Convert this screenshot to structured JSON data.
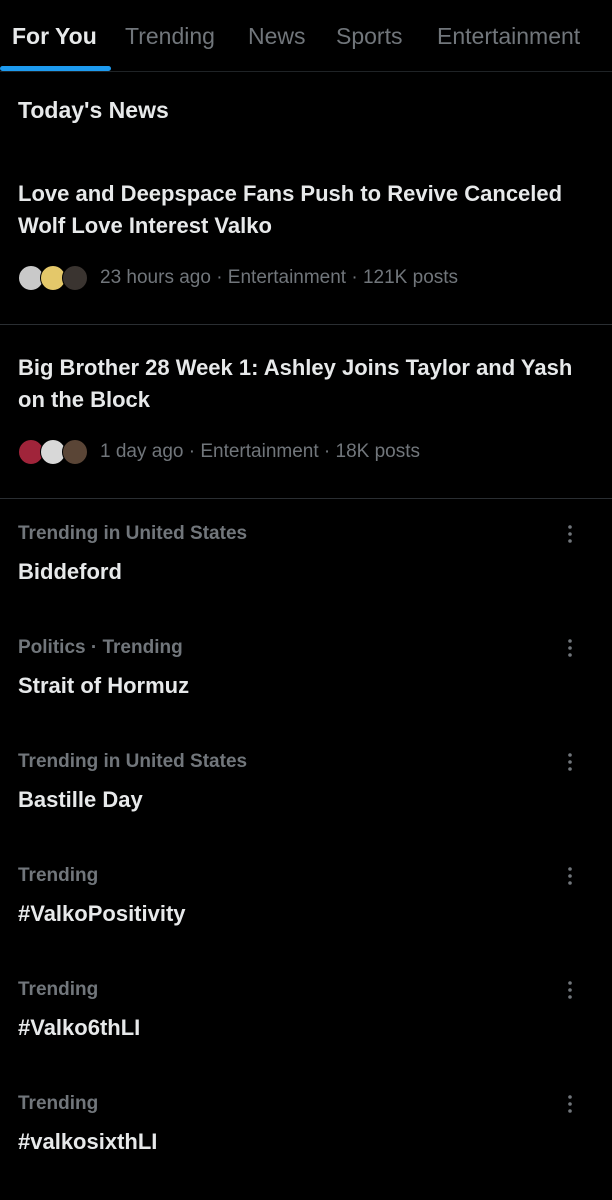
{
  "tabs": [
    {
      "label": "For You",
      "active": true
    },
    {
      "label": "Trending",
      "active": false
    },
    {
      "label": "News",
      "active": false
    },
    {
      "label": "Sports",
      "active": false
    },
    {
      "label": "Entertainment",
      "active": false
    }
  ],
  "section_title": "Today's News",
  "news": [
    {
      "headline": "Love and Deepspace Fans Push to Revive Canceled Wolf Love Interest Valko",
      "meta": "23 hours ago · Entertainment · 121K posts",
      "avatar_colors": [
        "#c9c9c9",
        "#e4c86a",
        "#3a3430"
      ]
    },
    {
      "headline": "Big Brother 28 Week 1: Ashley Joins Taylor and Yash on the Block",
      "meta": "1 day ago · Entertainment · 18K posts",
      "avatar_colors": [
        "#a0243a",
        "#d8d8d8",
        "#5a4536"
      ]
    }
  ],
  "trends": [
    {
      "context": "Trending in United States",
      "name": "Biddeford"
    },
    {
      "context": "Politics · Trending",
      "name": "Strait of Hormuz"
    },
    {
      "context": "Trending in United States",
      "name": "Bastille Day"
    },
    {
      "context": "Trending",
      "name": "#ValkoPositivity"
    },
    {
      "context": "Trending",
      "name": "#Valko6thLI"
    },
    {
      "context": "Trending",
      "name": "#valkosixthLI"
    }
  ],
  "colors": {
    "background": "#000000",
    "text_primary": "#e7e9ea",
    "text_secondary": "#71767b",
    "accent": "#1d9bf0",
    "divider": "#2a2e32"
  },
  "icons": {
    "more": "more-vertical-icon"
  }
}
